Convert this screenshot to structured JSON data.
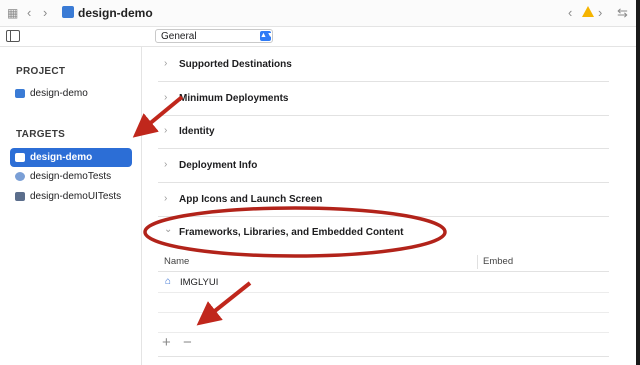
{
  "toolbar": {
    "grid_icon": "grid-icon",
    "back_glyph": "‹",
    "forward_glyph": "›",
    "project_title": "design-demo",
    "right_back_glyph": "‹",
    "right_forward_glyph": "›",
    "split_glyph": "⇆"
  },
  "editor_selector": {
    "value": "General",
    "arrow": "⌃"
  },
  "sidebar": {
    "project_header": "PROJECT",
    "project_item": "design-demo",
    "targets_header": "TARGETS",
    "targets": [
      {
        "label": "design-demo",
        "selected": true
      },
      {
        "label": "design-demoTests",
        "selected": false
      },
      {
        "label": "design-demoUITests",
        "selected": false
      }
    ]
  },
  "sections": [
    {
      "title": "Supported Destinations",
      "chevron": "›"
    },
    {
      "title": "Minimum Deployments",
      "chevron": "›"
    },
    {
      "title": "Identity",
      "chevron": "›"
    },
    {
      "title": "Deployment Info",
      "chevron": "›"
    },
    {
      "title": "App Icons and Launch Screen",
      "chevron": "›"
    },
    {
      "title": "Frameworks, Libraries, and Embedded Content",
      "chevron": "⌄"
    }
  ],
  "frameworks_table": {
    "columns": [
      "Name",
      "Embed"
    ],
    "rows": [
      {
        "name": "IMGLYUI",
        "embed": ""
      }
    ],
    "add_glyph": "+",
    "remove_glyph": "−"
  },
  "colors": {
    "accent": "#2c6ed6",
    "annotation": "#c0271c",
    "warning": "#f5b400"
  }
}
